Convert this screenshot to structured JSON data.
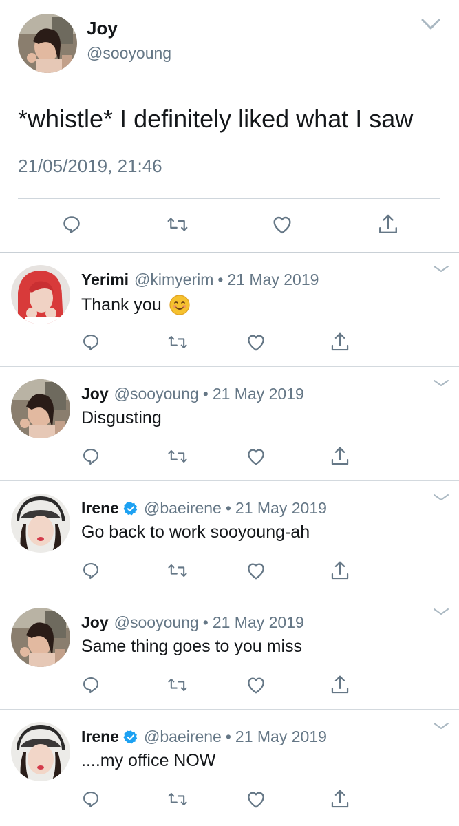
{
  "main_tweet": {
    "name": "Joy",
    "handle": "@sooyoung",
    "text": "*whistle* I definitely liked what I saw",
    "timestamp": "21/05/2019, 21:46",
    "actions": [
      "reply-icon",
      "retweet-icon",
      "like-icon",
      "share-icon"
    ]
  },
  "replies": [
    {
      "name": "Yerimi",
      "verified": false,
      "handle": "@kimyerim",
      "separator": "•",
      "date": "21 May 2019",
      "text": "Thank you",
      "emoji": "smiling-face-emoji",
      "avatar": "red-hair-avatar"
    },
    {
      "name": "Joy",
      "verified": false,
      "handle": "@sooyoung",
      "separator": "•",
      "date": "21 May 2019",
      "text": "Disgusting",
      "avatar": "joy-avatar"
    },
    {
      "name": "Irene",
      "verified": true,
      "handle": "@baeirene",
      "separator": "•",
      "date": "21 May 2019",
      "text": "Go back to work sooyoung-ah",
      "avatar": "irene-avatar"
    },
    {
      "name": "Joy",
      "verified": false,
      "handle": "@sooyoung",
      "separator": "•",
      "date": "21 May 2019",
      "text": "Same thing goes to you miss",
      "avatar": "joy-avatar"
    },
    {
      "name": "Irene",
      "verified": true,
      "handle": "@baeirene",
      "separator": "•",
      "date": "21 May 2019",
      "text": "....my office NOW",
      "avatar": "irene-avatar"
    }
  ],
  "colors": {
    "text_primary": "#14171a",
    "text_secondary": "#657786",
    "icon": "#657786",
    "verified_blue": "#1da1f2",
    "divider": "#cfd6dc"
  }
}
